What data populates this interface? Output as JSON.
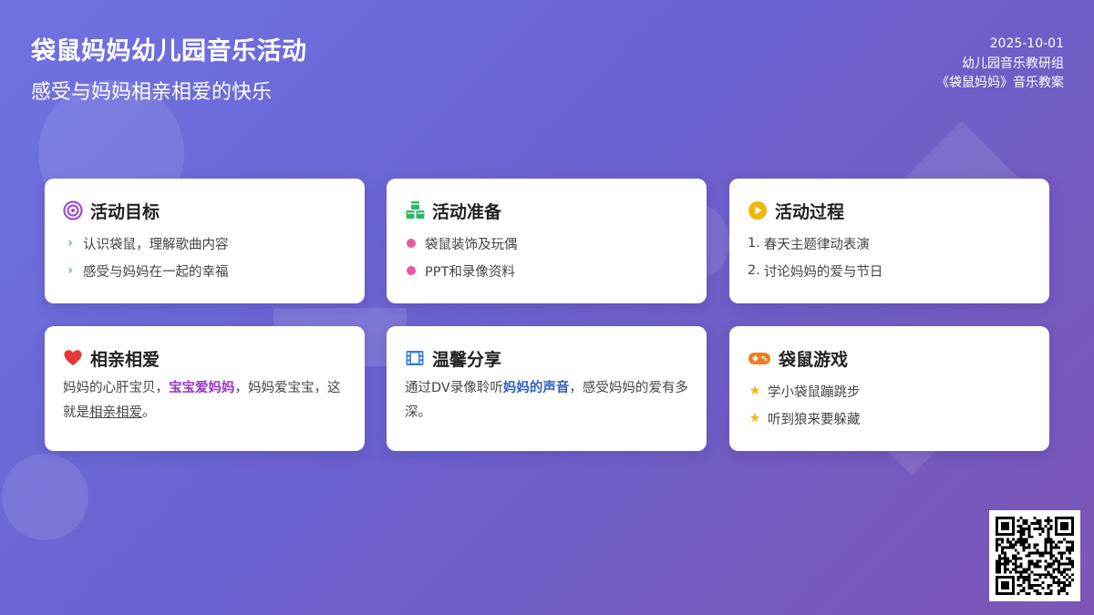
{
  "header": {
    "title": "袋鼠妈妈幼儿园音乐活动",
    "subtitle": "感受与妈妈相亲相爱的快乐",
    "date": "2025-10-01",
    "group": "幼儿园音乐教研组",
    "plan": "《袋鼠妈妈》音乐教案"
  },
  "cards": {
    "goal": {
      "title": "活动目标",
      "icon": "target-icon",
      "items": [
        "认识袋鼠，理解歌曲内容",
        "感受与妈妈在一起的幸福"
      ]
    },
    "prep": {
      "title": "活动准备",
      "icon": "cubes-icon",
      "items": [
        "袋鼠装饰及玩偶",
        "PPT和录像资料"
      ]
    },
    "process": {
      "title": "活动过程",
      "icon": "play-icon",
      "items": [
        "春天主题律动表演",
        "讨论妈妈的爱与节日"
      ],
      "numbers": [
        "1.",
        "2."
      ]
    },
    "love": {
      "title": "相亲相爱",
      "icon": "heart-icon",
      "text_a": "妈妈的心肝宝贝，",
      "text_b": "宝宝爱妈妈",
      "text_c": "，妈妈爱宝宝，这就是",
      "text_d": "相亲相爱",
      "text_e": "。"
    },
    "share": {
      "title": "温馨分享",
      "icon": "film-icon",
      "text_a": "通过DV录像聆听",
      "text_b": "妈妈的声音",
      "text_c": "，感受妈妈的爱有多深。"
    },
    "game": {
      "title": "袋鼠游戏",
      "icon": "gamepad-icon",
      "items": [
        "学小袋鼠蹦跳步",
        "听到狼来要躲藏"
      ]
    }
  },
  "colors": {
    "accent_purple": "#9a33c8",
    "accent_blue": "#2f5fc4",
    "bullet_pink": "#e8589f",
    "star_yellow": "#f5b50a",
    "chevron_blue": "#4a86d6"
  }
}
